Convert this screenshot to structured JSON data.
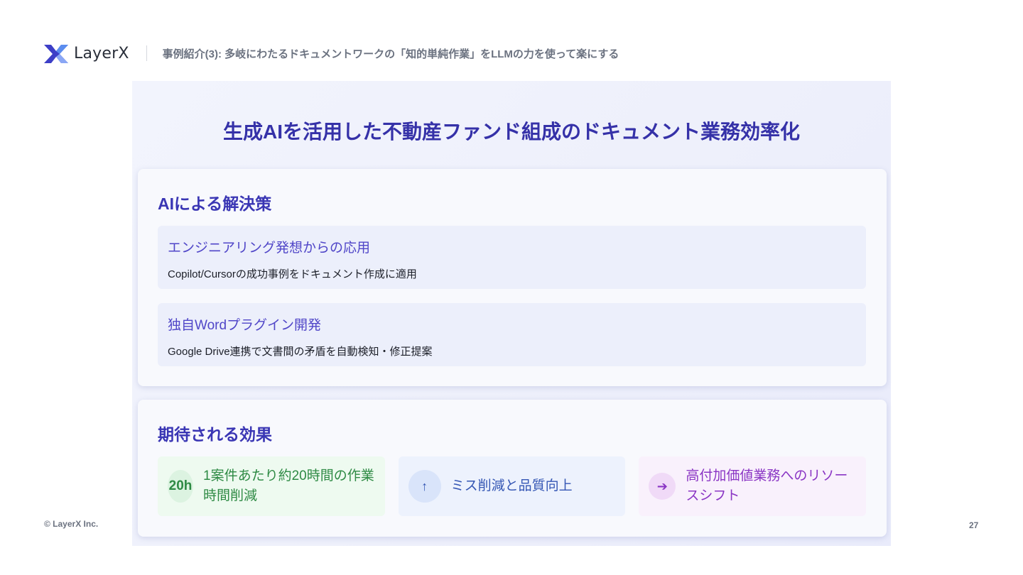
{
  "header": {
    "logo_text": "LayerX",
    "logo_icon": "layerx-logo-mark",
    "title": "事例紹介(3): 多岐にわたるドキュメントワークの「知的単純作業」をLLMの力を使って楽にする"
  },
  "slide": {
    "title": "生成AIを活用した不動産ファンド組成のドキュメント業務効率化",
    "solutions": {
      "heading": "AIによる解決策",
      "items": [
        {
          "title": "エンジニアリング発想からの応用",
          "description": "Copilot/Cursorの成功事例をドキュメント作成に適用"
        },
        {
          "title": "独自Wordプラグイン開発",
          "description": "Google Drive連携で文書間の矛盾を自動検知・修正提案"
        }
      ]
    },
    "effects": {
      "heading": "期待される効果",
      "items": [
        {
          "badge": "20h",
          "text": "1案件あたり約20時間の作業時間削減",
          "color": "#2e8a44"
        },
        {
          "badge": "↑",
          "badge_icon": "arrow-up-icon",
          "text": "ミス削減と品質向上",
          "color": "#3456b4"
        },
        {
          "badge": "➔",
          "badge_icon": "arrow-right-icon",
          "text": "高付加価値業務へのリソースシフト",
          "color": "#8a35c4"
        }
      ]
    }
  },
  "footer": {
    "copyright": "© LayerX Inc.",
    "page_number": "27"
  },
  "colors": {
    "accent": "#3531a8",
    "panel_bg": "#eef0fb"
  }
}
